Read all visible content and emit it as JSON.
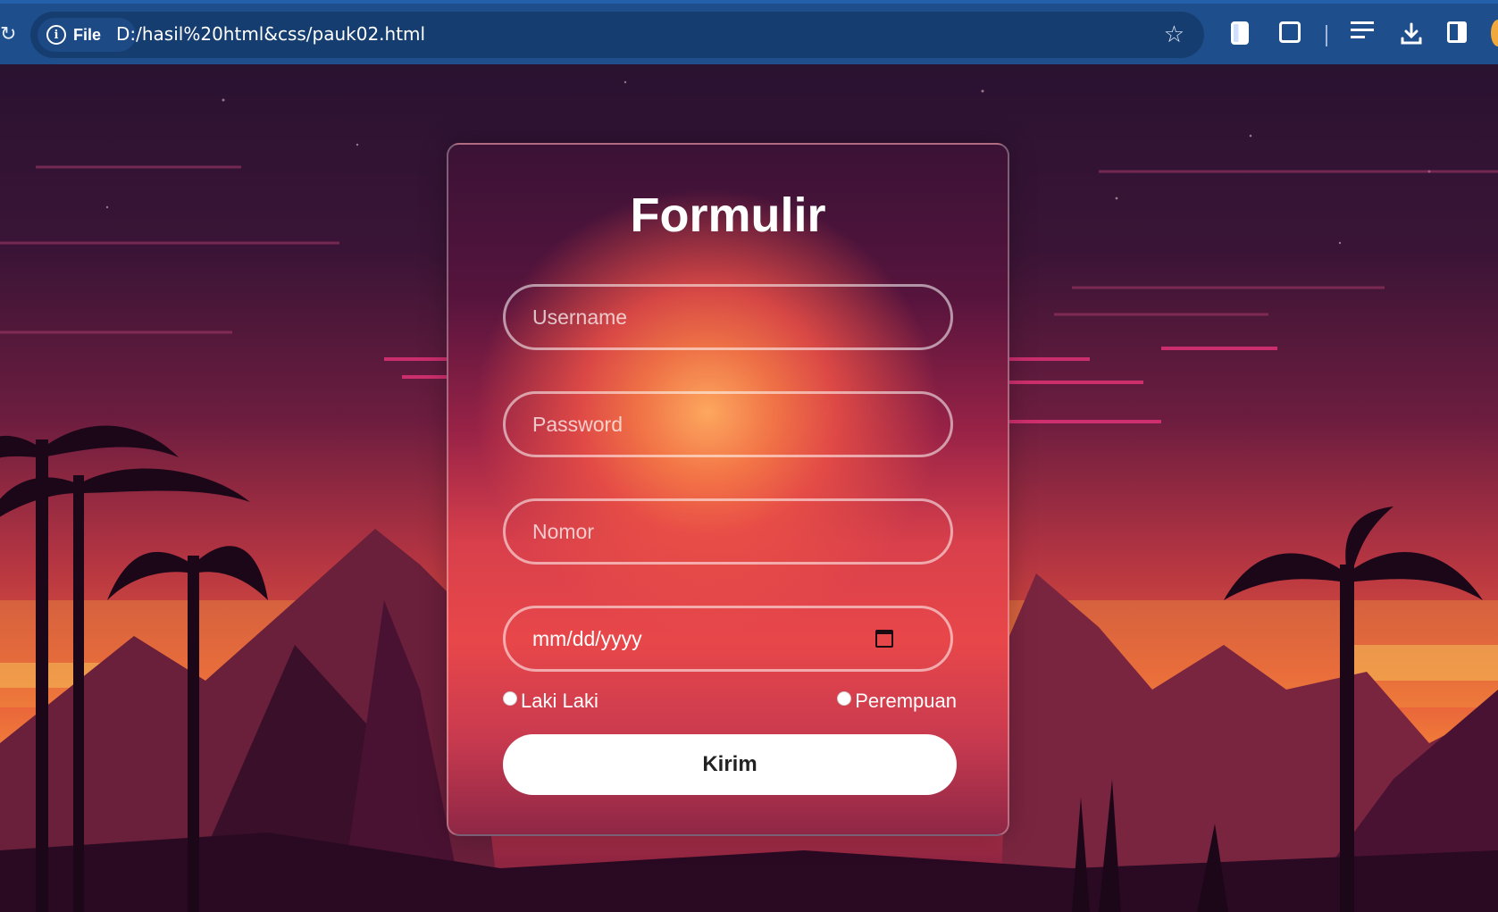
{
  "browser": {
    "site_chip_label": "File",
    "url": "D:/hasil%20html&css/pauk02.html"
  },
  "form": {
    "title": "Formulir",
    "username_placeholder": "Username",
    "password_placeholder": "Password",
    "nomor_placeholder": "Nomor",
    "date_placeholder": "mm/dd/yyyy",
    "gender_options": [
      "Laki Laki",
      "Perempuan"
    ],
    "submit_label": "Kirim"
  },
  "icons": {
    "address_bar": [
      "info-icon",
      "star-icon"
    ],
    "toolbar": [
      "notes-icon",
      "extensions-icon",
      "media-icon",
      "download-icon",
      "side-panel-icon",
      "profile-icon"
    ],
    "date_field": "calendar-icon"
  },
  "colors": {
    "chrome": "#1e4e8c",
    "omnibox": "#153d70",
    "button_bg": "#ffffff",
    "sun_glow": "#f7935a"
  }
}
